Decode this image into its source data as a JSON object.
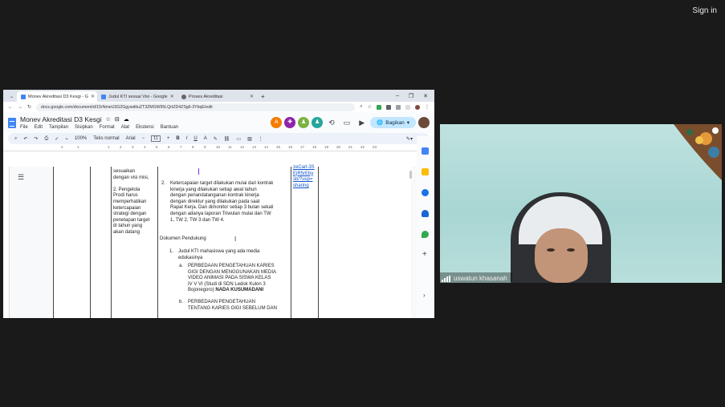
{
  "meeting": {
    "sign_in": "Sign in"
  },
  "browser": {
    "tabs": [
      {
        "title": "Monev Akreditasi D3 Kesgi - G",
        "active": true,
        "color": "#4285f4"
      },
      {
        "title": "Judul KTI sesuai Visi - Google",
        "active": false,
        "color": "#4285f4"
      },
      {
        "title": "Proses Akreditasi",
        "active": false,
        "color": "#555555"
      }
    ],
    "url": "docs.google.com/document/d/15rNmeU3G2GgywdituZT3ZMGW95LQrtZD4ZSg6-3YbqE/edit"
  },
  "doc": {
    "title": "Monev Akreditasi D3 Kesgi",
    "menu": [
      "File",
      "Edit",
      "Tampilan",
      "Sisipkan",
      "Format",
      "Alat",
      "Ekstensi",
      "Bantuan"
    ],
    "share_label": "Bagikan",
    "toolbar": {
      "zoom": "100%",
      "style": "Teks normal",
      "font": "Arial",
      "size": "11"
    },
    "ruler_ticks": [
      "2",
      "1",
      "1",
      "2",
      "3",
      "4",
      "5",
      "6",
      "7",
      "8",
      "9",
      "10",
      "11",
      "12",
      "13",
      "14",
      "15",
      "16",
      "17",
      "18",
      "19",
      "20",
      "21",
      "22",
      "23"
    ],
    "col_b": [
      "sesuaikan",
      "dengan visi misi,",
      "",
      "2. Pengelola",
      "Prodi harus",
      "memperhatikan",
      "ketercapaian",
      "strategi dengan",
      "penetapan target",
      "di tahun yang",
      "akan datang"
    ],
    "item2_num": "2.",
    "item2": [
      "Ketercapaian target dilakukan mulai dari kontrak",
      "kinerja yang dilakukan setiap awal tahun",
      "dengan penandatanganan kontrak kinerja",
      "dengan direktur yang dilakukan pada saat",
      "Rapat Kerja. Dan dimonitor setiap 3 bulan sekali",
      "dengan adanya laporan Triwulan mulai dan TW",
      "1, TW 2, TW 3 dan TW 4."
    ],
    "dokumen_heading": "Dokumen Pendukung",
    "list1_num": "1.",
    "list1": [
      "Judul KTI mahasiswa yang ada media",
      "edukasinya"
    ],
    "sub_a_label": "a.",
    "sub_a": [
      "PERBEDAAN PENGETAHUAN KARIES",
      "GIGI DENGAN MENGGUNAKAN MEDIA",
      "VIDEO ANIMASI PADA SISWA KELAS",
      "IV V VI (Studi di SDN Ledok Kulon 3"
    ],
    "sub_a_last": "Bojonegoro)",
    "sub_a_bold": "NADA KUSUMADANI",
    "sub_b_label": "b.",
    "sub_b": [
      "PERBEDAAN PENGETAHUAN",
      "TENTANG KARIES GIGI SEBELUM DAN"
    ],
    "link_lines": [
      "zeCarl-3S",
      "EjR5rEby",
      "sb/?usp=",
      "sharing"
    ]
  },
  "participant": {
    "name": "uswatun khasanah"
  }
}
